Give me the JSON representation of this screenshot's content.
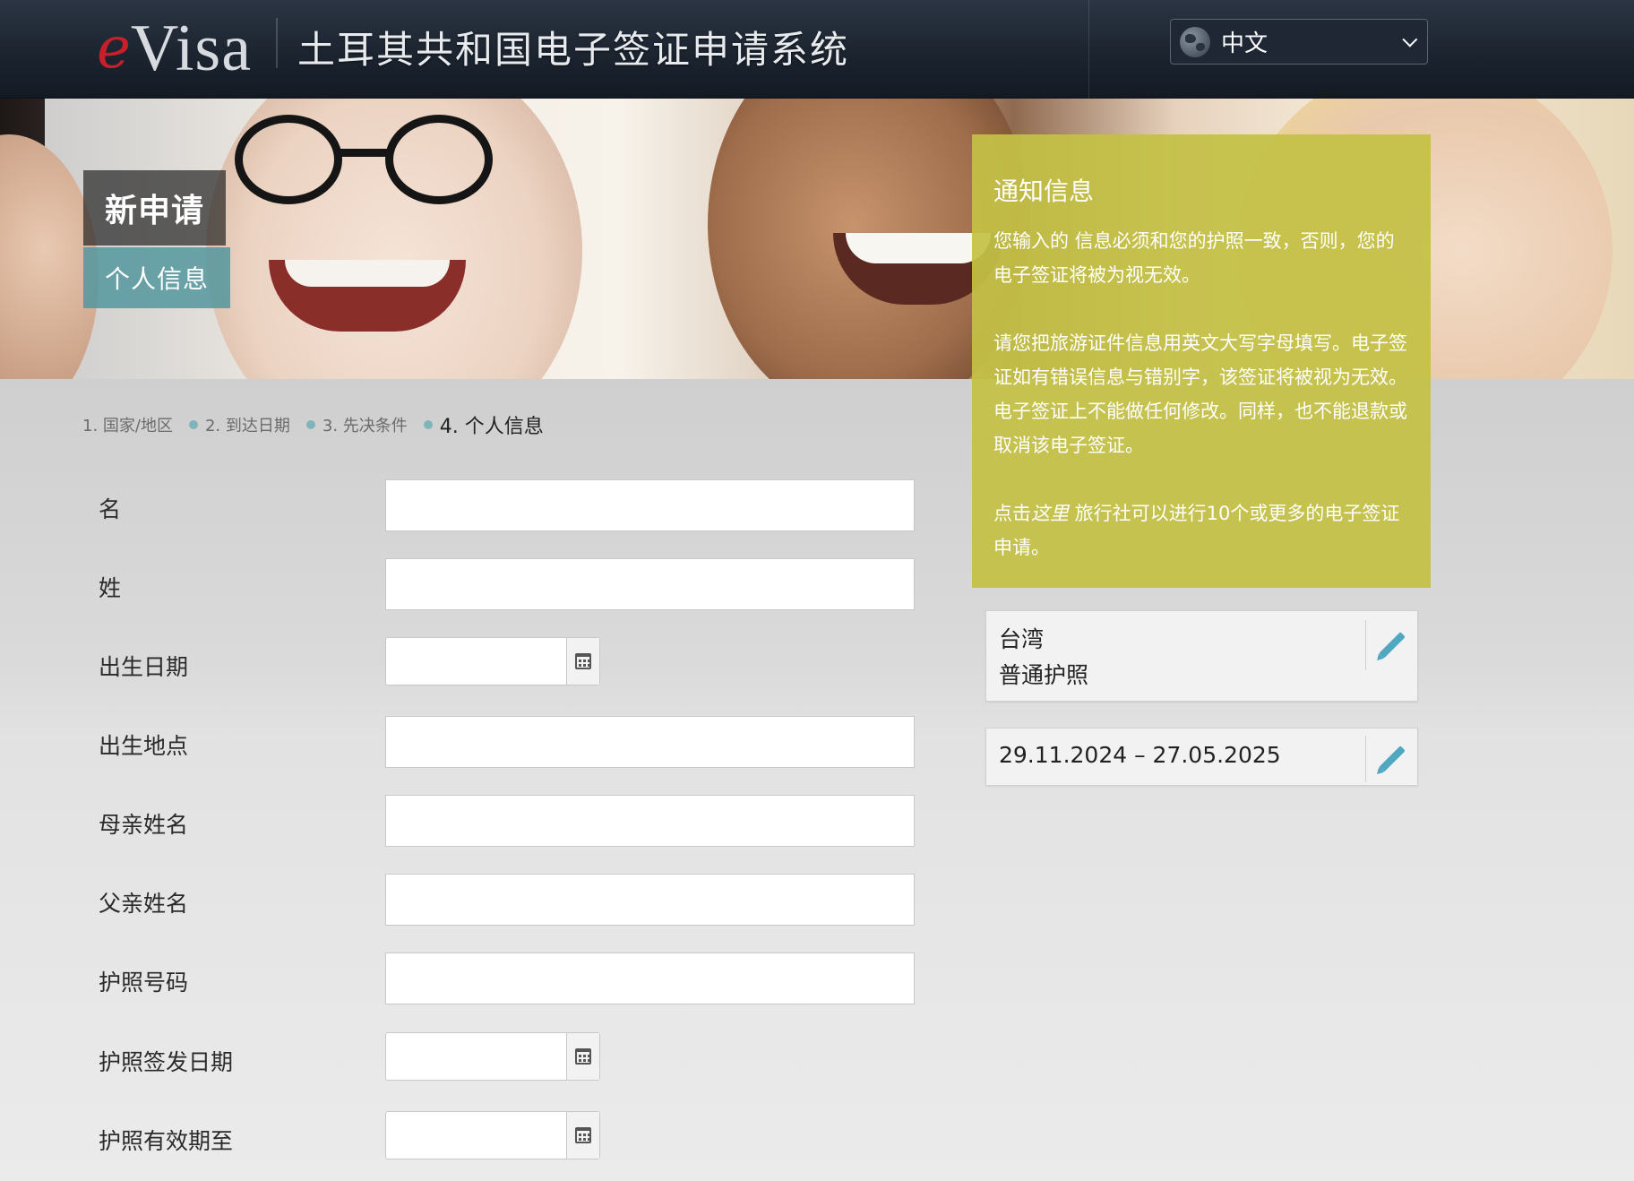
{
  "header": {
    "logo_e": "e",
    "logo_visa": "Visa",
    "site_title": "土耳其共和国电子签证申请系统",
    "language": "中文"
  },
  "hero": {
    "title": "新申请",
    "subtitle": "个人信息"
  },
  "notice": {
    "title": "通知信息",
    "para1": "您输入的 信息必须和您的护照一致，否则，您的电子签证将被为视无效。",
    "para2": "请您把旅游证件信息用英文大写字母填写。电子签证如有错误信息与错别字，该签证将被视为无效。电子签证上不能做任何修改。同样，也不能退款或取消该电子签证。",
    "para3_prefix": "点击",
    "para3_link": "这里",
    "para3_suffix": " 旅行社可以进行10个或更多的电子签证申请。"
  },
  "steps": [
    {
      "label": "1. 国家/地区"
    },
    {
      "label": "2. 到达日期"
    },
    {
      "label": "3. 先决条件"
    },
    {
      "label": "4. 个人信息"
    }
  ],
  "form": {
    "given_name": {
      "label": "名",
      "value": ""
    },
    "surname": {
      "label": "姓",
      "value": ""
    },
    "birth_date": {
      "label": "出生日期",
      "value": ""
    },
    "birth_place": {
      "label": "出生地点",
      "value": ""
    },
    "mother_name": {
      "label": "母亲姓名",
      "value": ""
    },
    "father_name": {
      "label": "父亲姓名",
      "value": ""
    },
    "passport_no": {
      "label": "护照号码",
      "value": ""
    },
    "passport_issue_date": {
      "label": "护照签发日期",
      "value": ""
    },
    "passport_expiry": {
      "label": "护照有效期至",
      "value": ""
    }
  },
  "summary": {
    "country": "台湾",
    "document_type": "普通护照",
    "date_range": "29.11.2024 – 27.05.2025"
  },
  "colors": {
    "header_bg": "#1c2430",
    "notice_bg": "#c4c146",
    "subtitle_bg": "#5496 9e",
    "accent_teal": "#4fa8c0",
    "logo_red": "#c8202a"
  }
}
